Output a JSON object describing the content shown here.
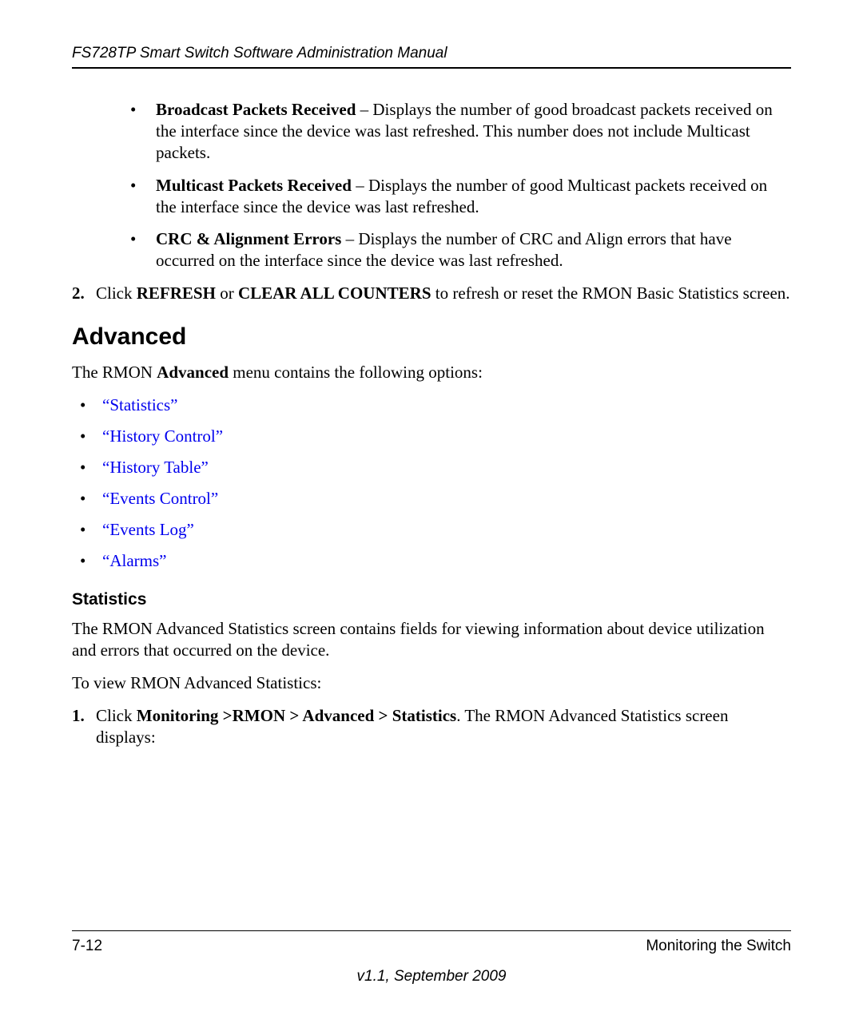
{
  "header": "FS728TP Smart Switch Software Administration Manual",
  "bullets": [
    {
      "term": "Broadcast Packets Received",
      "desc": " – Displays the number of good broadcast packets received on the interface since the device was last refreshed. This number does not include Multicast packets."
    },
    {
      "term": "Multicast Packets Received",
      "desc": " – Displays the number of good Multicast packets received on the interface since the device was last refreshed."
    },
    {
      "term": "CRC & Alignment Errors",
      "desc": " – Displays the number of CRC and Align errors that have occurred on the interface since the device was last refreshed."
    }
  ],
  "step2": {
    "num": "2.",
    "pre": "Click ",
    "refresh": "REFRESH",
    "mid": " or ",
    "clear": "CLEAR ALL COUNTERS",
    "post": " to refresh or reset the RMON Basic Statistics screen."
  },
  "advanced_heading": "Advanced",
  "advanced_intro_pre": "The RMON ",
  "advanced_intro_bold": "Advanced",
  "advanced_intro_post": " menu contains the following options:",
  "links": [
    "“Statistics”",
    "“History Control”",
    "“History Table”",
    "“Events Control”",
    "“Events Log”",
    "“Alarms”"
  ],
  "stats_heading": "Statistics",
  "stats_para1": "The RMON Advanced Statistics screen contains fields for viewing information about device utilization and errors that occurred on the device.",
  "stats_para2": "To view RMON Advanced Statistics:",
  "stats_step1": {
    "num": "1.",
    "pre": "Click ",
    "path": "Monitoring >RMON > Advanced > Statistics",
    "post": ". The RMON Advanced Statistics screen displays:"
  },
  "footer": {
    "left": "7-12",
    "right": "Monitoring the Switch",
    "version": "v1.1, September 2009"
  }
}
